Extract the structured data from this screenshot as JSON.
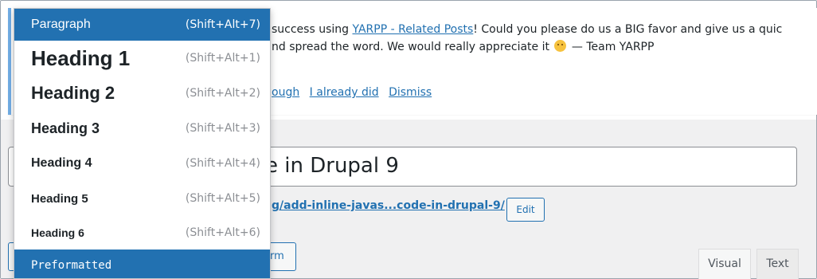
{
  "notice": {
    "text_prefix": "success using ",
    "plugin_link": "YARPP - Related Posts",
    "text_mid": "! Could you please do us a BIG favor and give us a quic",
    "line2_prefix": "nd spread the word. We would really appreciate it ",
    "line2_suffix": " — Team YARPP",
    "links": [
      "ough",
      "I already did",
      "Dismiss"
    ]
  },
  "post": {
    "title_value": "e in Drupal 9",
    "permalink": "g/add-inline-javas...code-in-drupal-9/",
    "edit_label": "Edit",
    "toolbar_button_label": "rm"
  },
  "editor_tabs": [
    "Visual",
    "Text"
  ],
  "format_dropdown": {
    "items": [
      {
        "label": "Paragraph",
        "shortcut": "(Shift+Alt+7)"
      },
      {
        "label": "Heading 1",
        "shortcut": "(Shift+Alt+1)"
      },
      {
        "label": "Heading 2",
        "shortcut": "(Shift+Alt+2)"
      },
      {
        "label": "Heading 3",
        "shortcut": "(Shift+Alt+3)"
      },
      {
        "label": "Heading 4",
        "shortcut": "(Shift+Alt+4)"
      },
      {
        "label": "Heading 5",
        "shortcut": "(Shift+Alt+5)"
      },
      {
        "label": "Heading 6",
        "shortcut": "(Shift+Alt+6)"
      },
      {
        "label": "Preformatted",
        "shortcut": ""
      }
    ]
  },
  "colors": {
    "accent": "#2271b1",
    "notice_border": "#72aee6",
    "page_bg": "#f0f0f1"
  }
}
